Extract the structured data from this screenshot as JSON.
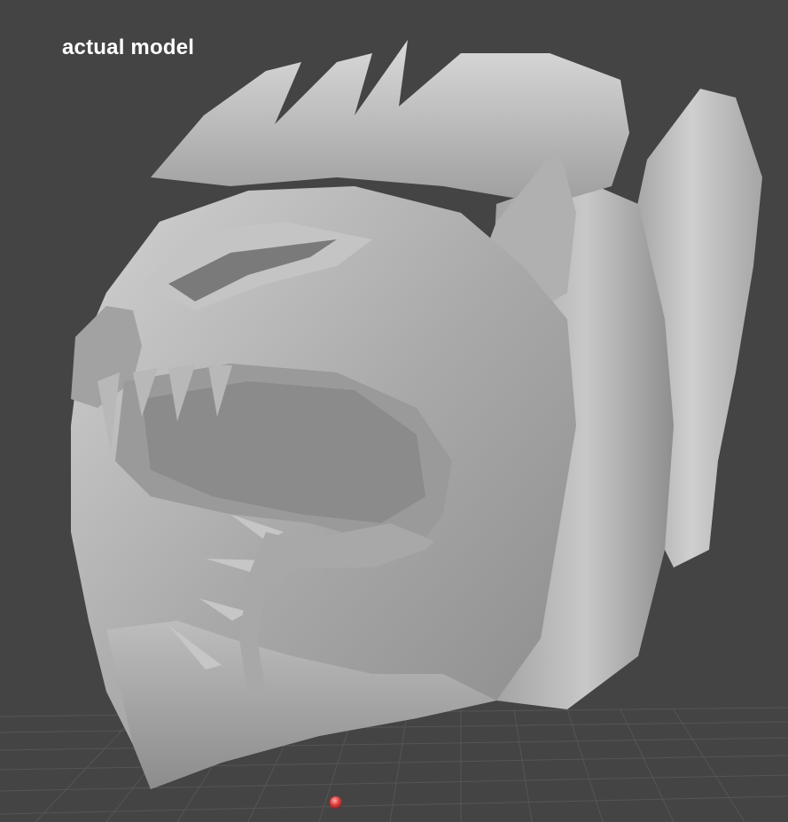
{
  "viewport": {
    "background_color": "#444444",
    "grid_color": "#5a5a5a",
    "model_color": "#b4b4b4",
    "origin_marker_color": "#e04040",
    "label": "actual model"
  },
  "scene": {
    "model_description_icon": "helmet-3d-model",
    "grid_icon": "floor-grid",
    "origin_icon": "origin-point-marker"
  }
}
